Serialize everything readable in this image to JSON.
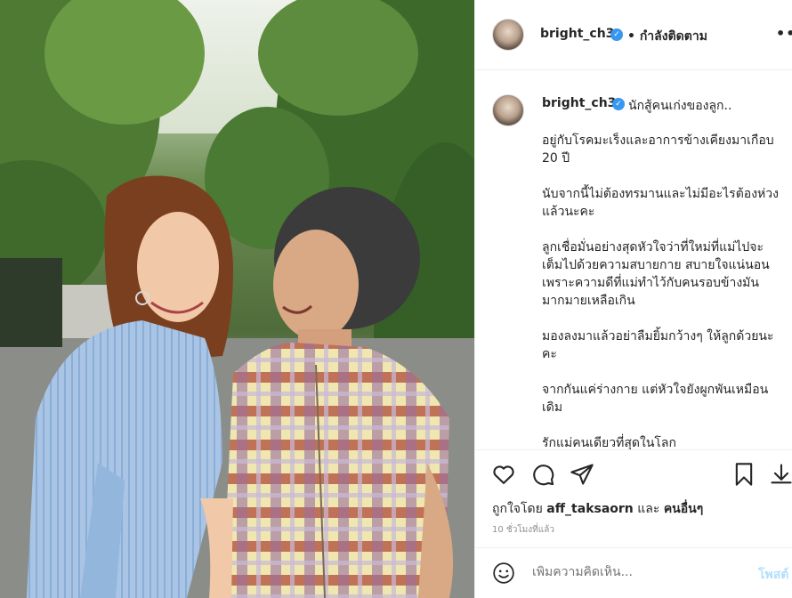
{
  "post": {
    "photo_alt": "photo-mother-daughter",
    "header": {
      "username": "bright_ch3",
      "verified_icon": "verified-badge-icon",
      "follow_status": "• กำลังติดตาม",
      "more_label": "•••"
    },
    "caption": {
      "username": "bright_ch3",
      "first_line": "นักสู้คนเก่งของลูก..",
      "paragraphs": [
        "อยู่กับโรคมะเร็งและอาการข้างเคียงมาเกือบ 20 ปี",
        "นับจากนี้ไม่ต้องทรมานและไม่มีอะไรต้องห่วงแล้วนะคะ",
        "ลูกเชื่อมั่นอย่างสุดหัวใจว่าที่ใหม่ที่แม่ไปจะเต็มไปด้วยความสบายกาย สบายใจแน่นอน เพราะความดีที่แม่ทำไว้กับคนรอบข้างมันมากมายเหลือเกิน",
        "มองลงมาแล้วอย่าลืมยิ้มกว้างๆ ให้ลูกด้วยนะคะ",
        "จากกันแค่ร่างกาย แต่หัวใจยังผูกพันเหมือนเดิม",
        "รักแม่คนเดียวที่สุดในโลก"
      ]
    },
    "actions": {
      "like_icon": "heart-icon",
      "comment_icon": "comment-icon",
      "share_icon": "share-icon",
      "save_icon": "bookmark-icon",
      "download_icon": "download-icon"
    },
    "likes": {
      "prefix": "ถูกใจโดย",
      "user": "aff_taksaorn",
      "and": "และ",
      "others": "คนอื่นๆ"
    },
    "timestamp": "10 ชั่วโมงที่แล้ว",
    "comment": {
      "emoji_icon": "emoji-icon",
      "placeholder": "เพิ่มความคิดเห็น...",
      "post_label": "โพสต์"
    }
  },
  "colors": {
    "accent": "#3897f0",
    "post_disabled": "#b2dffc",
    "text": "#262626",
    "muted": "#8e8e8e",
    "border": "#efefef"
  }
}
